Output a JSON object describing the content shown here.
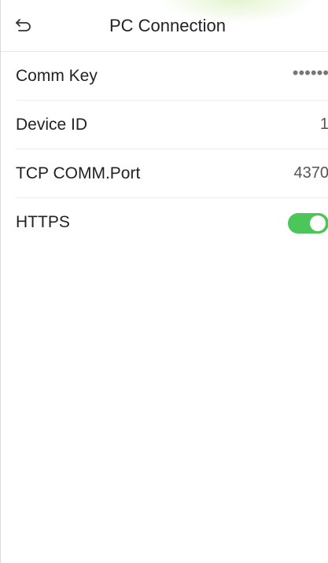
{
  "header": {
    "title": "PC Connection",
    "back_icon": "back-arrow-icon"
  },
  "settings": {
    "comm_key": {
      "label": "Comm Key",
      "value": "••••••"
    },
    "device_id": {
      "label": "Device ID",
      "value": "1"
    },
    "tcp_port": {
      "label": "TCP COMM.Port",
      "value": "4370"
    },
    "https": {
      "label": "HTTPS",
      "enabled": true
    }
  },
  "colors": {
    "toggle_on": "#4cc55a",
    "text": "#222222",
    "divider": "#ececec"
  }
}
